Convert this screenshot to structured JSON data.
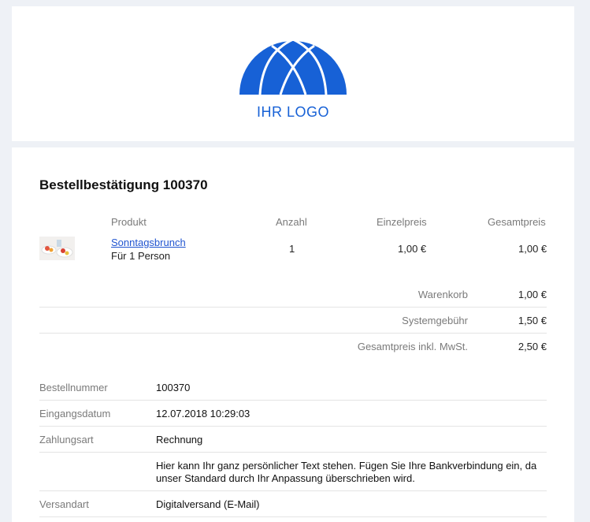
{
  "logo": {
    "text": "IHR LOGO",
    "color": "#1761d6"
  },
  "order": {
    "title": "Bestellbestätigung 100370"
  },
  "table": {
    "headers": {
      "product": "Produkt",
      "quantity": "Anzahl",
      "unit_price": "Einzelpreis",
      "total_price": "Gesamtpreis"
    },
    "rows": [
      {
        "name": "Sonntagsbrunch",
        "sub": "Für 1 Person",
        "quantity": "1",
        "unit_price": "1,00 €",
        "total_price": "1,00 €"
      }
    ]
  },
  "summary": {
    "cart_label": "Warenkorb",
    "cart_value": "1,00 €",
    "fee_label": "Systemgebühr",
    "fee_value": "1,50 €",
    "total_label": "Gesamtpreis inkl. MwSt.",
    "total_value": "2,50 €"
  },
  "info": {
    "order_number_label": "Bestellnummer",
    "order_number_value": "100370",
    "date_label": "Eingangsdatum",
    "date_value": "12.07.2018 10:29:03",
    "payment_label": "Zahlungsart",
    "payment_value": "Rechnung",
    "payment_note": "Hier kann Ihr ganz persönlicher Text stehen. Fügen Sie Ihre Bankverbindung ein, da unser Standard durch Ihr Anpassung überschrieben wird.",
    "shipping_label": "Versandart",
    "shipping_value": "Digitalversand (E-Mail)"
  }
}
